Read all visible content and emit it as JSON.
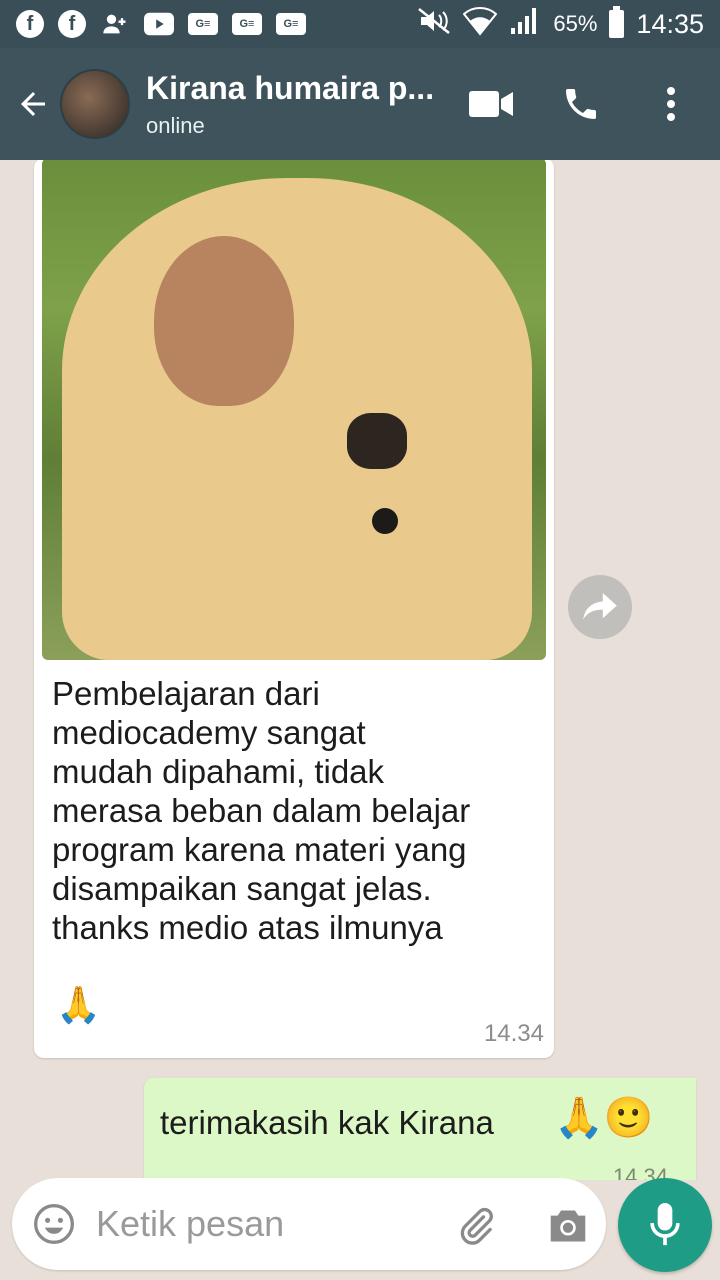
{
  "status_bar": {
    "battery": "65%",
    "time": "14:35"
  },
  "header": {
    "contact_name": "Kirana humaira p...",
    "status": "online"
  },
  "messages": [
    {
      "direction": "incoming",
      "type": "image",
      "caption": "Pembelajaran dari\nmediocademy sangat\nmudah dipahami, tidak\nmerasa beban dalam belajar\nprogram karena materi yang\ndisampaikan sangat jelas.\nthanks medio atas ilmunya",
      "emoji": "🙏",
      "time": "14.34"
    },
    {
      "direction": "outgoing",
      "text": "terimakasih kak Kirana",
      "emoji": "🙏🙂",
      "time": "14.34"
    }
  ],
  "composer": {
    "placeholder": "Ketik pesan"
  },
  "colors": {
    "header": "#3f535c",
    "statusbar": "#3a4e57",
    "outgoing_bubble": "#dcf8c6",
    "mic_button": "#1f9c86",
    "chat_background": "#e8e0d8"
  }
}
